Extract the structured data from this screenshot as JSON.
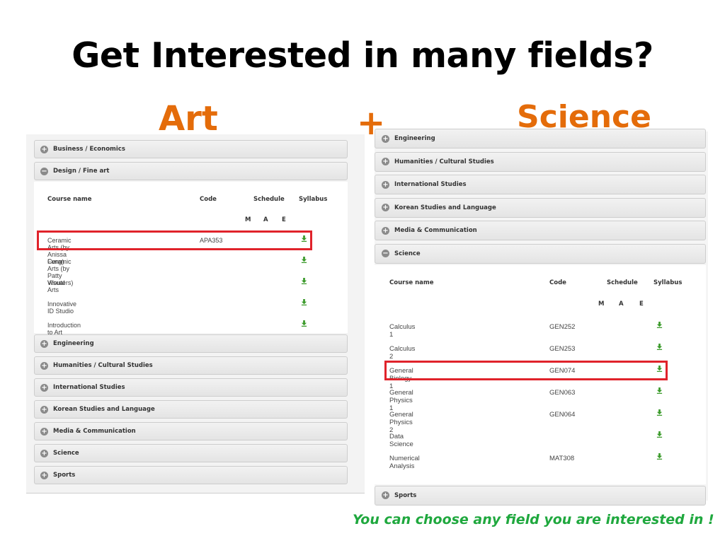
{
  "slide": {
    "title": "Get Interested in many fields?",
    "label_art": "Art",
    "label_plus": "+",
    "label_science": "Science",
    "footer_note": "You can choose any field you are interested in !"
  },
  "colors": {
    "accent_orange": "#e46c0a",
    "highlight_red": "#e0232b",
    "note_green": "#1fa83e",
    "download_green": "#3a9a2a"
  },
  "left_panel": {
    "sections_before": [
      {
        "label": "Business / Economics",
        "state": "collapsed"
      }
    ],
    "open_section": {
      "label": "Design / Fine art",
      "state": "expanded",
      "headers": {
        "course": "Course name",
        "code": "Code",
        "schedule": "Schedule",
        "syllabus": "Syllabus"
      },
      "schedule_sub": [
        "M",
        "A",
        "E"
      ],
      "rows": [
        {
          "name": "Ceramic Arts (by Anissa Fung)",
          "code": "APA353",
          "syllabus_icon": "download-icon",
          "highlighted": true
        },
        {
          "name": "Ceramic Arts (by Patty Wouters)",
          "code": "",
          "syllabus_icon": "download-icon",
          "highlighted": false
        },
        {
          "name": "Visual Arts",
          "code": "",
          "syllabus_icon": "download-icon",
          "highlighted": false
        },
        {
          "name": "Innovative ID Studio",
          "code": "",
          "syllabus_icon": "download-icon",
          "highlighted": false
        },
        {
          "name": "Introduction to Art",
          "code": "",
          "syllabus_icon": "download-icon",
          "highlighted": false
        }
      ]
    },
    "sections_after": [
      {
        "label": "Engineering",
        "state": "collapsed"
      },
      {
        "label": "Humanities / Cultural Studies",
        "state": "collapsed"
      },
      {
        "label": "International Studies",
        "state": "collapsed"
      },
      {
        "label": "Korean Studies and Language",
        "state": "collapsed"
      },
      {
        "label": "Media & Communication",
        "state": "collapsed"
      },
      {
        "label": "Science",
        "state": "collapsed"
      },
      {
        "label": "Sports",
        "state": "collapsed"
      }
    ]
  },
  "right_panel": {
    "sections_before": [
      {
        "label": "Engineering",
        "state": "collapsed"
      },
      {
        "label": "Humanities / Cultural Studies",
        "state": "collapsed"
      },
      {
        "label": "International Studies",
        "state": "collapsed"
      },
      {
        "label": "Korean Studies and Language",
        "state": "collapsed"
      },
      {
        "label": "Media & Communication",
        "state": "collapsed"
      }
    ],
    "open_section": {
      "label": "Science",
      "state": "expanded",
      "headers": {
        "course": "Course name",
        "code": "Code",
        "schedule": "Schedule",
        "syllabus": "Syllabus"
      },
      "schedule_sub": [
        "M",
        "A",
        "E"
      ],
      "rows": [
        {
          "name": "Calculus 1",
          "code": "GEN252",
          "syllabus_icon": "download-icon",
          "highlighted": false
        },
        {
          "name": "Calculus 2",
          "code": "GEN253",
          "syllabus_icon": "download-icon",
          "highlighted": false
        },
        {
          "name": "General Biology 1",
          "code": "GEN074",
          "syllabus_icon": "download-icon",
          "highlighted": true
        },
        {
          "name": "General Physics 1",
          "code": "GEN063",
          "syllabus_icon": "download-icon",
          "highlighted": false
        },
        {
          "name": "General Physics 2",
          "code": "GEN064",
          "syllabus_icon": "download-icon",
          "highlighted": false
        },
        {
          "name": "Data Science",
          "code": "",
          "syllabus_icon": "download-icon",
          "highlighted": false
        },
        {
          "name": "Numerical Analysis",
          "code": "MAT308",
          "syllabus_icon": "download-icon",
          "highlighted": false
        }
      ]
    },
    "sections_after": [
      {
        "label": "Sports",
        "state": "collapsed"
      }
    ]
  }
}
